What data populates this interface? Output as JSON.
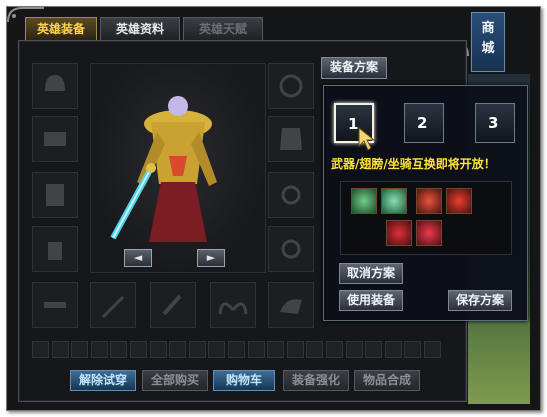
{
  "tabs": [
    {
      "label": "英雄装备",
      "state": "active"
    },
    {
      "label": "英雄资料",
      "state": "normal"
    },
    {
      "label": "英雄天赋",
      "state": "disabled"
    }
  ],
  "store": {
    "label_line1": "商",
    "label_line2": "城"
  },
  "equip_scheme_button": "装备方案",
  "scheme_popup": {
    "slots": [
      {
        "number": "1",
        "selected": true
      },
      {
        "number": "2",
        "selected": false
      },
      {
        "number": "3",
        "selected": false
      }
    ],
    "notice": "武器/翅膀/坐骑互换即将开放！",
    "items": [
      {
        "icon": "ring-icon",
        "color": "#3f9e5a"
      },
      {
        "icon": "amulet-icon",
        "color": "#4fae7a"
      },
      {
        "icon": "helm-icon",
        "color": "#b23a2a"
      },
      {
        "icon": "crest-icon",
        "color": "#c0302a"
      },
      {
        "icon": "gauntlet-icon",
        "color": "#b8282a"
      },
      {
        "icon": "claw-icon",
        "color": "#c8283a"
      }
    ],
    "cancel_label": "取消方案",
    "use_label": "使用装备",
    "save_label": "保存方案"
  },
  "rotate_left": "◄",
  "rotate_right": "►",
  "bottom_buttons": [
    {
      "label": "解除试穿",
      "style": "blue"
    },
    {
      "label": "全部购买",
      "style": "dim"
    },
    {
      "label": "购物车",
      "style": "blue"
    },
    {
      "label": "装备强化",
      "style": "dim"
    },
    {
      "label": "物品合成",
      "style": "dim"
    }
  ],
  "colors": {
    "accent_gold": "#ffd34a",
    "notice_yellow": "#ffe23a",
    "panel_bg": "#141618"
  }
}
